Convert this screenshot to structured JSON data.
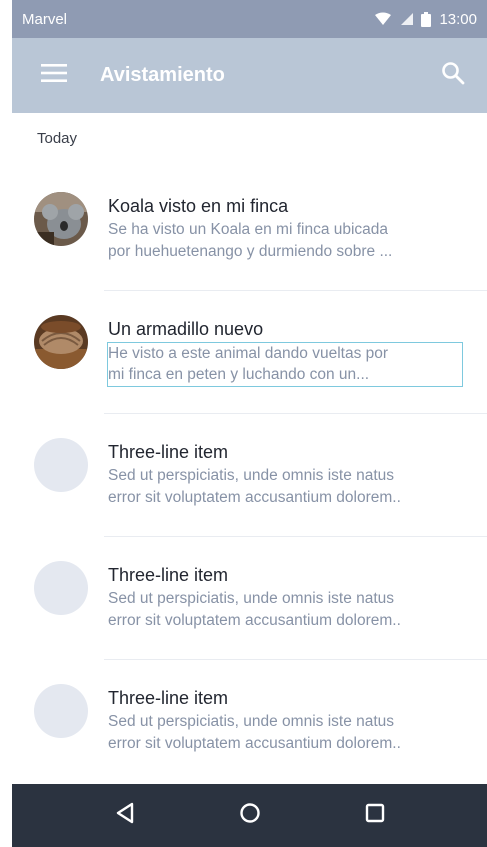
{
  "status_bar": {
    "carrier": "Marvel",
    "time": "13:00",
    "icons": [
      "wifi-icon",
      "cell-signal-icon",
      "battery-icon"
    ]
  },
  "app_bar": {
    "title": "Avistamiento",
    "menu_icon": "menu-icon",
    "search_icon": "search-icon"
  },
  "list": {
    "subheader": "Today",
    "items": [
      {
        "title": "Koala visto en mi finca",
        "line1": "Se ha visto un Koala en mi finca ubicada",
        "line2": "por huehuetenango y durmiendo sobre  ...",
        "avatar": "koala-photo"
      },
      {
        "title": "Un armadillo nuevo",
        "line1": "He visto a este animal dando vueltas por",
        "line2": "mi finca en peten y luchando con un...",
        "avatar": "armadillo-photo"
      },
      {
        "title": "Three-line item",
        "line1": "Sed ut perspiciatis, unde omnis iste natus",
        "line2": "error sit voluptatem accusantium dolorem..",
        "avatar": "placeholder"
      },
      {
        "title": "Three-line item",
        "line1": "Sed ut perspiciatis, unde omnis iste natus",
        "line2": "error sit voluptatem accusantium dolorem..",
        "avatar": "placeholder"
      },
      {
        "title": "Three-line item",
        "line1": "Sed ut perspiciatis, unde omnis iste natus",
        "line2": "error sit voluptatem accusantium dolorem..",
        "avatar": "placeholder"
      }
    ]
  },
  "nav_bar": {
    "buttons": [
      "back-icon",
      "home-icon",
      "recents-icon"
    ]
  },
  "colors": {
    "status_bar": "#8f9bb3",
    "app_bar": "#b9c6d6",
    "nav_bar": "#2b3340",
    "avatar_placeholder": "#e4e8f0",
    "secondary_text": "#8792a6",
    "selection_outline": "#7ec9de"
  }
}
